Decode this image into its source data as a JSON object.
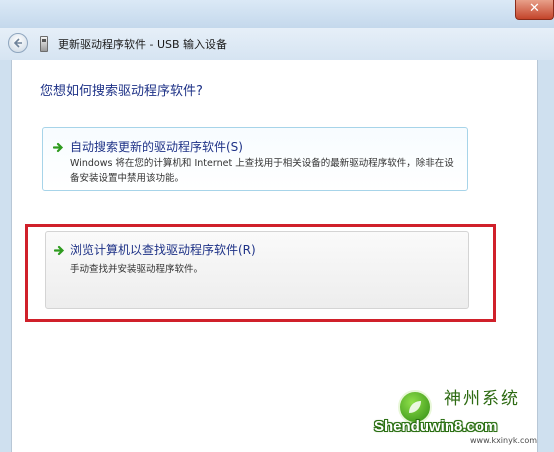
{
  "window": {
    "close_label": "✕",
    "title": "更新驱动程序软件 - USB 输入设备"
  },
  "content": {
    "question": "您想如何搜索驱动程序软件?",
    "options": [
      {
        "title": "自动搜索更新的驱动程序软件(S)",
        "description": "Windows 将在您的计算机和 Internet 上查找用于相关设备的最新驱动程序软件，除非在设备安装设置中禁用该功能。"
      },
      {
        "title": "浏览计算机以查找驱动程序软件(R)",
        "description": "手动查找并安装驱动程序软件。"
      }
    ]
  },
  "watermark": {
    "chinese": "神州系统",
    "main": "Shenduwin8.com",
    "url": "www.kxinyk.com"
  },
  "colors": {
    "link_blue": "#1e3287",
    "highlight_red": "#d0202a",
    "arrow_green": "#2e9b1f"
  }
}
